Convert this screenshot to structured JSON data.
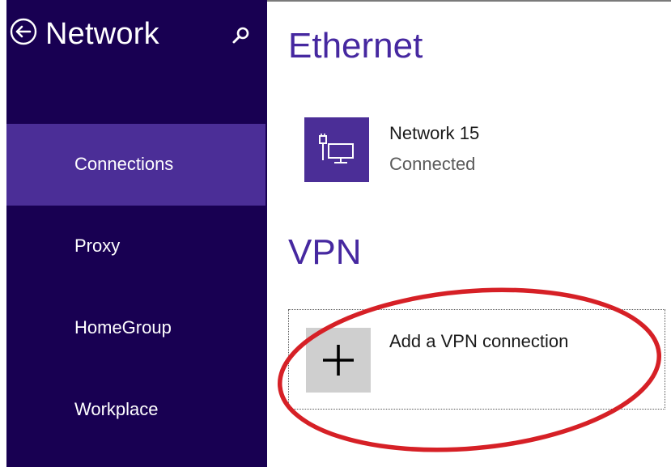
{
  "sidebar": {
    "title": "Network",
    "back_icon": "back-arrow-circle-icon",
    "search_icon": "search-icon",
    "items": [
      {
        "label": "Connections",
        "selected": true
      },
      {
        "label": "Proxy",
        "selected": false
      },
      {
        "label": "HomeGroup",
        "selected": false
      },
      {
        "label": "Workplace",
        "selected": false
      }
    ]
  },
  "main": {
    "ethernet": {
      "heading": "Ethernet",
      "connection": {
        "name": "Network  15",
        "status": "Connected",
        "icon": "ethernet-network-icon"
      }
    },
    "vpn": {
      "heading": "VPN",
      "add_label": "Add a VPN connection",
      "add_icon": "plus-icon"
    }
  },
  "annotation": {
    "shape": "ellipse",
    "color": "#d62026",
    "target": "add-vpn-connection"
  },
  "colors": {
    "sidebar_bg": "#180052",
    "selected_item_bg": "#4b2e97",
    "accent": "#4628a0",
    "tile_grey": "#cfcfcf"
  }
}
